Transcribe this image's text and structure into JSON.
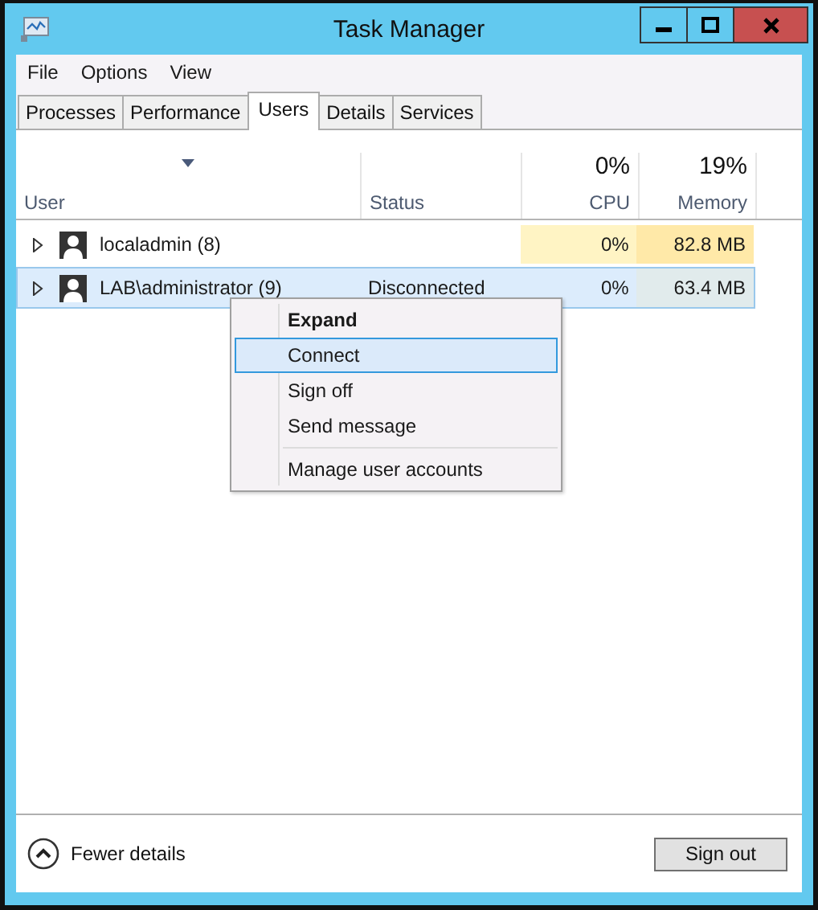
{
  "window": {
    "title": "Task Manager"
  },
  "menu": [
    "File",
    "Options",
    "View"
  ],
  "tabs": [
    {
      "label": "Processes",
      "selected": false
    },
    {
      "label": "Performance",
      "selected": false
    },
    {
      "label": "Users",
      "selected": true
    },
    {
      "label": "Details",
      "selected": false
    },
    {
      "label": "Services",
      "selected": false
    }
  ],
  "table": {
    "columns": [
      {
        "label": "User",
        "sorted": true
      },
      {
        "label": "Status",
        "sorted": false
      },
      {
        "label": "CPU",
        "summary": "0%",
        "sorted": false
      },
      {
        "label": "Memory",
        "summary": "19%",
        "sorted": false
      }
    ],
    "rows": [
      {
        "user": "localadmin (8)",
        "status": "",
        "cpu": {
          "text": "0%",
          "color": "#fff4c4"
        },
        "memory": {
          "text": "82.8 MB",
          "color": "#ffe9a8"
        },
        "selected": false,
        "expanded": false
      },
      {
        "user": "LAB\\administrator (9)",
        "status": "Disconnected",
        "cpu": {
          "text": "0%",
          "color": "#dcecfc"
        },
        "memory": {
          "text": "63.4 MB",
          "color": "#e1ebec"
        },
        "selected": true,
        "expanded": false
      }
    ]
  },
  "context_menu": {
    "items": [
      {
        "kind": "default",
        "label": "Expand",
        "selected": false
      },
      {
        "kind": "item",
        "label": "Connect",
        "selected": true
      },
      {
        "kind": "item",
        "label": "Sign off",
        "selected": false
      },
      {
        "kind": "item",
        "label": "Send message",
        "selected": false
      },
      {
        "kind": "separator"
      },
      {
        "kind": "item",
        "label": "Manage user accounts",
        "selected": false
      }
    ]
  },
  "footer": {
    "fewer_details": "Fewer details",
    "sign_out": "Sign out"
  }
}
